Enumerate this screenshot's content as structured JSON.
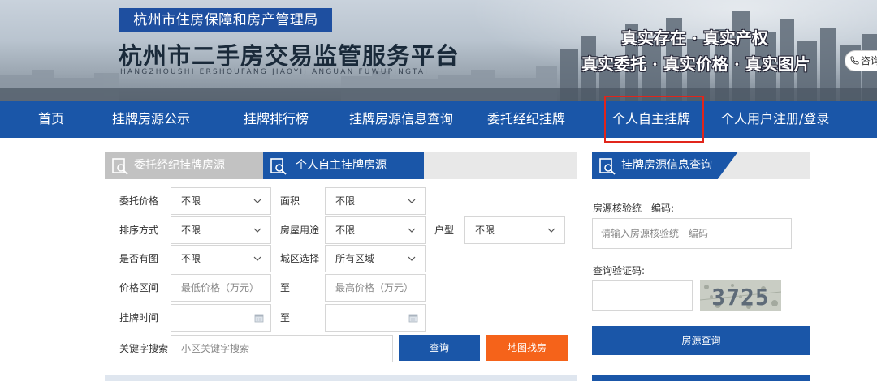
{
  "header": {
    "org_name": "杭州市住房保障和房产管理局",
    "site_title": "杭州市二手房交易监管服务平台",
    "site_pinyin": "HANGZHOUSHI  ERSHOUFANG  JIAOYIJIANGUAN  FUWUPINGTAI",
    "slogan_line1": "真实存在 · 真实产权",
    "slogan_line2": "真实委托 · 真实价格 · 真实图片",
    "consult_label": "咨询"
  },
  "nav": {
    "items": [
      {
        "label": "首页"
      },
      {
        "label": "挂牌房源公示"
      },
      {
        "label": "挂牌排行榜"
      },
      {
        "label": "挂牌房源信息查询"
      },
      {
        "label": "委托经纪挂牌"
      },
      {
        "label": "个人自主挂牌"
      },
      {
        "label": "个人用户注册/登录"
      }
    ],
    "highlighted_index": 5
  },
  "search_panel": {
    "tabs": [
      {
        "label": "委托经纪挂牌房源",
        "active": false
      },
      {
        "label": "个人自主挂牌房源",
        "active": true
      }
    ],
    "filters": {
      "commission_price": {
        "label": "委托价格",
        "value": "不限"
      },
      "area": {
        "label": "面积",
        "value": "不限"
      },
      "sort": {
        "label": "排序方式",
        "value": "不限"
      },
      "usage": {
        "label": "房屋用途",
        "value": "不限"
      },
      "layout": {
        "label": "户型",
        "value": "不限"
      },
      "has_photo": {
        "label": "是否有图",
        "value": "不限"
      },
      "district": {
        "label": "城区选择",
        "value": "所有区域"
      },
      "price_range": {
        "label": "价格区间",
        "min_placeholder": "最低价格（万元）",
        "to": "至",
        "max_placeholder": "最高价格（万元）"
      },
      "listing_time": {
        "label": "挂牌时间",
        "to": "至"
      },
      "keyword": {
        "label": "关键字搜索",
        "placeholder": "小区关键字搜索"
      }
    },
    "query_button": "查询",
    "map_button": "地图找房"
  },
  "info_query": {
    "title": "挂牌房源信息查询",
    "code_label": "房源核验统一编码:",
    "code_placeholder": "请输入房源核验统一编码",
    "captcha_label": "查询验证码:",
    "captcha_text": "3725",
    "submit_button": "房源查询"
  },
  "colors": {
    "primary_blue": "#1a56a8",
    "badge_blue": "#1e4fa0",
    "map_orange": "#f5631a",
    "highlight_red": "#e1251b"
  }
}
